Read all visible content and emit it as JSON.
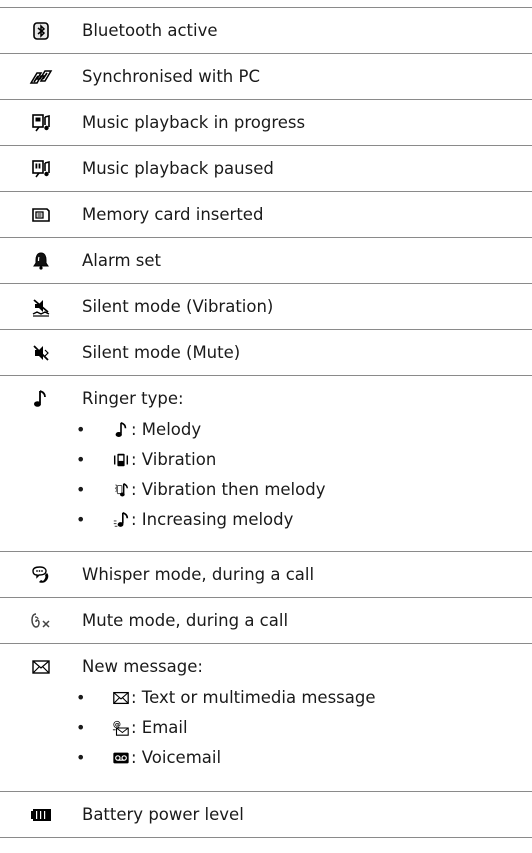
{
  "rows": [
    {
      "icon": "bluetooth-icon",
      "label": "Bluetooth active"
    },
    {
      "icon": "sync-pc-icon",
      "label": "Synchronised with PC"
    },
    {
      "icon": "music-playing-icon",
      "label": "Music playback in progress"
    },
    {
      "icon": "music-paused-icon",
      "label": "Music playback paused"
    },
    {
      "icon": "memory-card-icon",
      "label": "Memory card inserted"
    },
    {
      "icon": "alarm-bell-icon",
      "label": "Alarm set"
    },
    {
      "icon": "silent-vibration-icon",
      "label": "Silent mode (Vibration)"
    },
    {
      "icon": "silent-mute-icon",
      "label": "Silent mode (Mute)"
    },
    {
      "icon": "ringer-note-icon",
      "label": "Ringer type:",
      "subitems": [
        {
          "icon": "melody-icon",
          "label": ": Melody"
        },
        {
          "icon": "vibration-icon",
          "label": ": Vibration"
        },
        {
          "icon": "vibration-then-melody-icon",
          "label": ": Vibration then melody"
        },
        {
          "icon": "increasing-melody-icon",
          "label": ": Increasing melody"
        }
      ]
    },
    {
      "icon": "whisper-mode-icon",
      "label": "Whisper mode, during a call"
    },
    {
      "icon": "mute-call-icon",
      "label": "Mute mode, during a call"
    },
    {
      "icon": "envelope-icon",
      "label": "New message:",
      "subitems": [
        {
          "icon": "text-message-icon",
          "label": ": Text or multimedia message"
        },
        {
          "icon": "email-icon",
          "label": ": Email"
        },
        {
          "icon": "voicemail-icon",
          "label": " : Voicemail"
        }
      ]
    },
    {
      "icon": "battery-icon",
      "label": "Battery power level"
    }
  ],
  "bullet_char": "•"
}
